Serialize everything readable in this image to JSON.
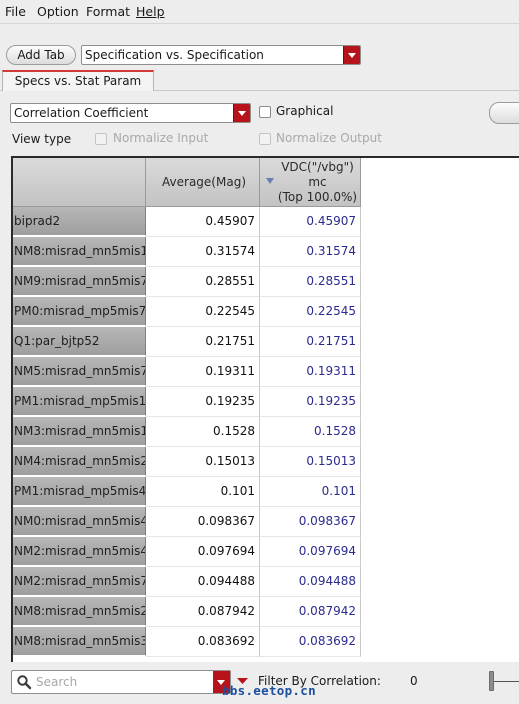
{
  "menu": {
    "file": "File",
    "option": "Option",
    "format": "Format",
    "help": "Help"
  },
  "toolbar": {
    "add_tab_label": "Add Tab",
    "view_selector_value": "Specification vs. Specification"
  },
  "tabs": [
    {
      "label": "Specs vs. Stat Param"
    }
  ],
  "options": {
    "metric_value": "Correlation Coefficient",
    "graphical_label": "Graphical",
    "view_type_label": "View type",
    "normalize_input_label": "Normalize Input",
    "normalize_output_label": "Normalize Output"
  },
  "table": {
    "headers": {
      "average": "Average(Mag)",
      "vdc_line1": "VDC(\"/vbg\")",
      "vdc_line2": "mc",
      "vdc_line3": "(Top 100.0%)"
    },
    "rows": [
      {
        "name": "biprad2",
        "average": "0.45907",
        "vdc": "0.45907"
      },
      {
        "name": "NM8:misrad_mn5mis1",
        "average": "0.31574",
        "vdc": "0.31574"
      },
      {
        "name": "NM9:misrad_mn5mis7",
        "average": "0.28551",
        "vdc": "0.28551"
      },
      {
        "name": "PM0:misrad_mp5mis7",
        "average": "0.22545",
        "vdc": "0.22545"
      },
      {
        "name": "Q1:par_bjtp52",
        "average": "0.21751",
        "vdc": "0.21751"
      },
      {
        "name": "NM5:misrad_mn5mis7",
        "average": "0.19311",
        "vdc": "0.19311"
      },
      {
        "name": "PM1:misrad_mp5mis1",
        "average": "0.19235",
        "vdc": "0.19235"
      },
      {
        "name": "NM3:misrad_mn5mis1",
        "average": "0.1528",
        "vdc": "0.1528"
      },
      {
        "name": "NM4:misrad_mn5mis2",
        "average": "0.15013",
        "vdc": "0.15013"
      },
      {
        "name": "PM1:misrad_mp5mis4",
        "average": "0.101",
        "vdc": "0.101"
      },
      {
        "name": "NM0:misrad_mn5mis4",
        "average": "0.098367",
        "vdc": "0.098367"
      },
      {
        "name": "NM2:misrad_mn5mis4",
        "average": "0.097694",
        "vdc": "0.097694"
      },
      {
        "name": "NM2:misrad_mn5mis7",
        "average": "0.094488",
        "vdc": "0.094488"
      },
      {
        "name": "NM8:misrad_mn5mis2",
        "average": "0.087942",
        "vdc": "0.087942"
      },
      {
        "name": "NM8:misrad_mn5mis3",
        "average": "0.083692",
        "vdc": "0.083692"
      }
    ]
  },
  "bottom": {
    "search_placeholder": "Search",
    "filter_label": "Filter By Correlation:",
    "filter_value": "0",
    "watermark": "bbs.eetop.cn"
  }
}
